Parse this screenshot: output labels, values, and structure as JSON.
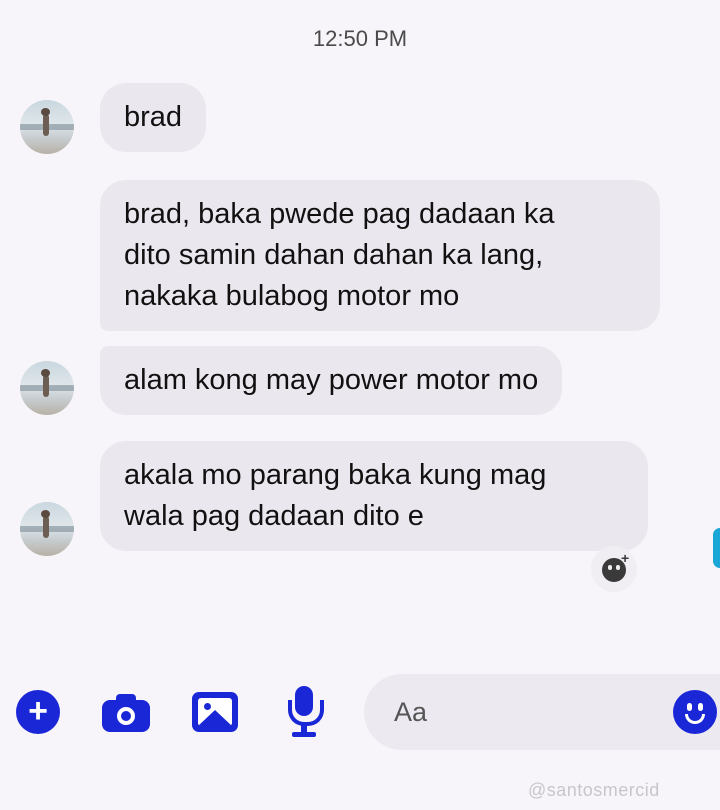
{
  "header": {
    "timestamp": "12:50 PM"
  },
  "messages": [
    {
      "text": "brad"
    },
    {
      "text_lines": [
        "brad, baka pwede pag dadaan ka",
        "dito samin dahan dahan ka lang,",
        "nakaka bulabog motor mo"
      ]
    },
    {
      "text": "alam kong may power motor mo"
    },
    {
      "text_lines": [
        "akala mo parang baka kung mag",
        "wala pag dadaan dito e"
      ]
    }
  ],
  "composer": {
    "placeholder": "Aa",
    "icons": [
      "plus-icon",
      "camera-icon",
      "gallery-icon",
      "microphone-icon",
      "emoji-icon"
    ],
    "accent_color": "#1a27d6"
  },
  "reaction_button": {
    "icon": "add-reaction-icon"
  },
  "watermark": {
    "text": "@santosmercid"
  },
  "colors": {
    "bubble": "#ebe7ee",
    "background": "#f7f5f9",
    "accent": "#1a27d6"
  }
}
